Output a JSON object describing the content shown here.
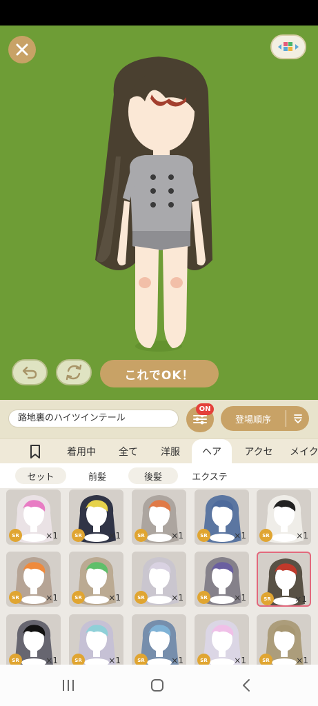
{
  "stage": {
    "ok_label": "これでOK！"
  },
  "search": {
    "value": "路地裏のハイツインテール"
  },
  "filter": {
    "badge": "ON"
  },
  "sort": {
    "label": "登場順序"
  },
  "tabs": [
    {
      "label": "着用中"
    },
    {
      "label": "全て"
    },
    {
      "label": "洋服"
    },
    {
      "label": "ヘア"
    },
    {
      "label": "アクセ"
    },
    {
      "label": "メイク"
    }
  ],
  "subtabs": [
    {
      "label": "セット"
    },
    {
      "label": "前髪"
    },
    {
      "label": "後髪"
    },
    {
      "label": "エクステ"
    }
  ],
  "items": [
    {
      "rarity": "SR",
      "qty": "×1",
      "hair": "#ece3e8",
      "accent": "#e87cc4"
    },
    {
      "rarity": "SR",
      "qty": "×1",
      "hair": "#1e2237",
      "accent": "#e6d24a"
    },
    {
      "rarity": "SR",
      "qty": "×1",
      "hair": "#a7a09a",
      "accent": "#e07a47"
    },
    {
      "rarity": "SR",
      "qty": "×1",
      "hair": "#4e6b9c",
      "accent": "#4e6b9c"
    },
    {
      "rarity": "SR",
      "qty": "×1",
      "hair": "#f2f0eb",
      "accent": "#222222"
    },
    {
      "rarity": "SR",
      "qty": "×1",
      "hair": "#b39f8f",
      "accent": "#ef8a3c"
    },
    {
      "rarity": "SR",
      "qty": "×1",
      "hair": "#b8a58c",
      "accent": "#5fbf6a"
    },
    {
      "rarity": "SR",
      "qty": "×1",
      "hair": "#c9c4cf",
      "accent": "#d9d2e2"
    },
    {
      "rarity": "SR",
      "qty": "×1",
      "hair": "#7c7883",
      "accent": "#6a5fa0"
    },
    {
      "rarity": "SR",
      "qty": "×1",
      "hair": "#4a4236",
      "accent": "#c0392b"
    },
    {
      "rarity": "SR",
      "qty": "×1",
      "hair": "#5b5a66",
      "accent": "#111111"
    },
    {
      "rarity": "SR",
      "qty": "×1",
      "hair": "#c4bfd6",
      "accent": "#8fd0d8"
    },
    {
      "rarity": "SR",
      "qty": "×1",
      "hair": "#6c86a8",
      "accent": "#7fb2d6"
    },
    {
      "rarity": "SR",
      "qty": "×1",
      "hair": "#dcd6e8",
      "accent": "#f0c0e8"
    },
    {
      "rarity": "SR",
      "qty": "×1",
      "hair": "#a79772",
      "accent": "#a79772"
    }
  ],
  "colors": {
    "stage_bg": "#6e9d36",
    "brand": "#c8a266",
    "badge_red": "#e4403a",
    "selected_border": "#e2687c"
  }
}
